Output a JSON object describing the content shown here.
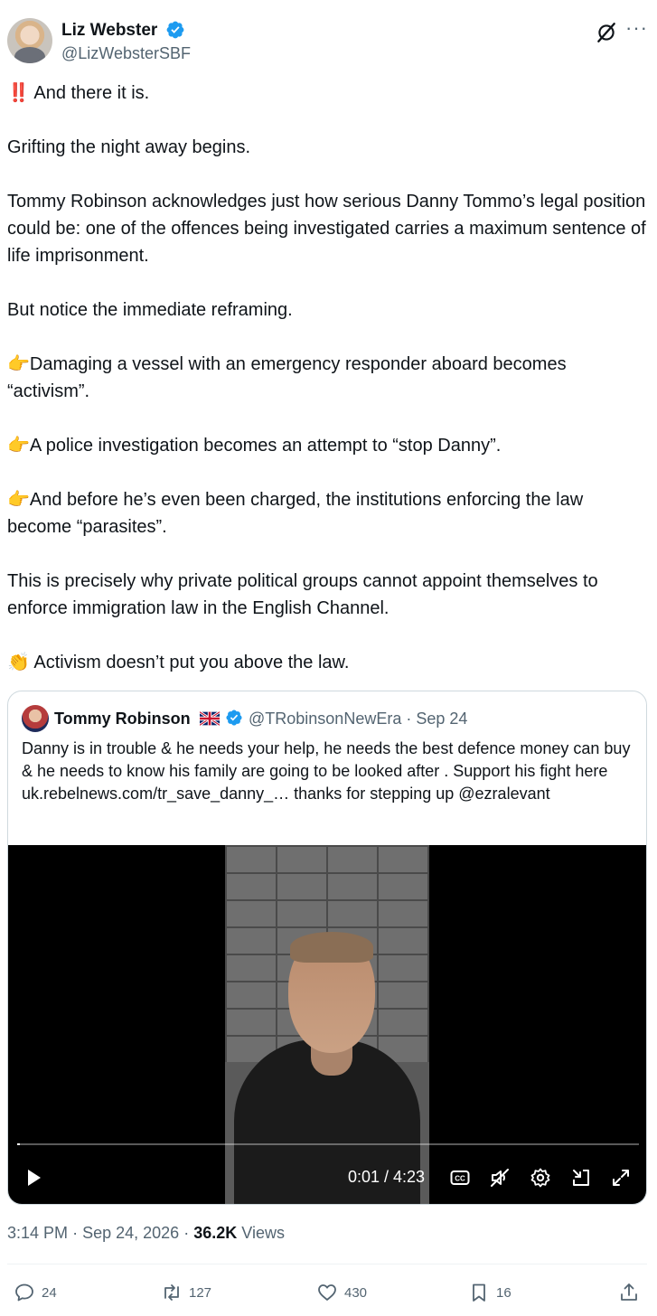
{
  "author": {
    "name": "Liz Webster",
    "handle": "@LizWebsterSBF"
  },
  "icons": {
    "verified": "verified-badge-icon",
    "grok": "grok-icon",
    "more": "more-icon"
  },
  "post": {
    "paragraphs": [
      {
        "emoji": "‼️",
        "text": " And there it is."
      },
      {
        "emoji": "",
        "text": "Grifting the night away begins."
      },
      {
        "emoji": "",
        "text": "Tommy Robinson acknowledges just how serious Danny Tommo’s legal position could be: one of the offences being investigated carries a maximum sentence of life imprisonment."
      },
      {
        "emoji": "",
        "text": "But notice the immediate reframing."
      },
      {
        "emoji": "👉",
        "text": "Damaging a vessel with an emergency responder aboard becomes “activism”."
      },
      {
        "emoji": "👉",
        "text": "A police investigation becomes an attempt to “stop Danny”."
      },
      {
        "emoji": "👉",
        "text": "And before he’s even been charged, the institutions enforcing the law become “parasites”."
      },
      {
        "emoji": "",
        "text": "This is precisely why private political groups cannot appoint themselves to enforce immigration law in the English Channel."
      },
      {
        "emoji": "👏",
        "text": " Activism doesn’t put you above the law."
      }
    ]
  },
  "quote": {
    "name": "Tommy Robinson",
    "handle": "@TRobinsonNewEra",
    "separator": "·",
    "date": "Sep 24",
    "text": "Danny is in trouble & he needs your help, he needs the best defence money can buy & he needs to know his family are going to be looked after . Support his fight here uk.rebelnews.com/tr_save_danny_… thanks for stepping up @ezralevant"
  },
  "video": {
    "current_time": "0:01",
    "duration": "4:23",
    "time_display": "0:01 / 4:23",
    "progress_fraction": 0.004
  },
  "meta": {
    "time": "3:14 PM",
    "separator": "·",
    "date": "Sep 24, 2026",
    "views_count": "36.2K",
    "views_label": "Views"
  },
  "actions": {
    "replies": "24",
    "reposts": "127",
    "likes": "430",
    "bookmarks": "16"
  },
  "colors": {
    "verified_blue": "#1d9bf0",
    "text": "#0f1419",
    "secondary": "#536471",
    "border": "#cfd9de"
  }
}
